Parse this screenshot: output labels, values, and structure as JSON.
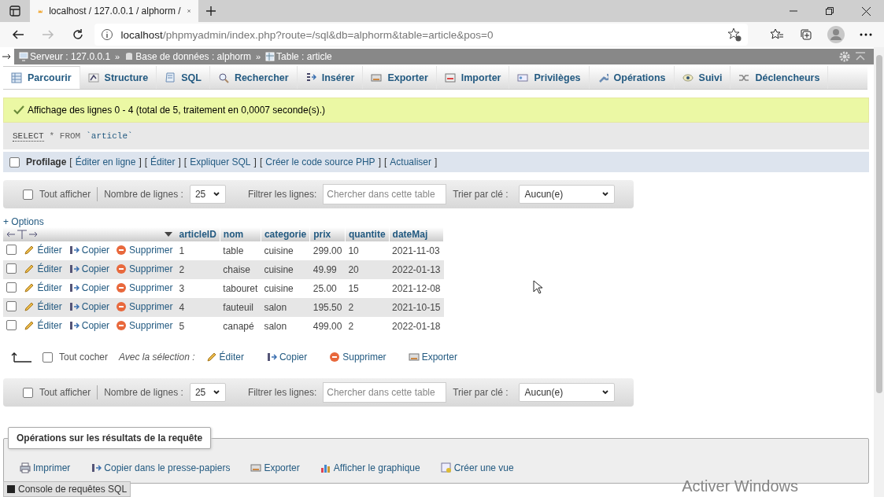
{
  "browser": {
    "tab_title": "localhost / 127.0.0.1 / alphorm /",
    "url_host": "localhost",
    "url_path": "/phpmyadmin/index.php?route=/sql&db=alphorm&table=article&pos=0",
    "forward": {
      "disabled": true
    }
  },
  "breadcrumb": {
    "separator": "»",
    "items": [
      {
        "kind": "server",
        "label": "Serveur : 127.0.0.1"
      },
      {
        "kind": "database",
        "label": "Base de données : alphorm"
      },
      {
        "kind": "table",
        "label": "Table : article"
      }
    ]
  },
  "tabs": [
    {
      "kind": "browse",
      "label": "Parcourir",
      "selected": true
    },
    {
      "kind": "structure",
      "label": "Structure",
      "selected": false
    },
    {
      "kind": "sql",
      "label": "SQL",
      "selected": false
    },
    {
      "kind": "search",
      "label": "Rechercher",
      "selected": false
    },
    {
      "kind": "insert",
      "label": "Insérer",
      "selected": false
    },
    {
      "kind": "export",
      "label": "Exporter",
      "selected": false
    },
    {
      "kind": "import",
      "label": "Importer",
      "selected": false
    },
    {
      "kind": "privileges",
      "label": "Privilèges",
      "selected": false
    },
    {
      "kind": "operations",
      "label": "Opérations",
      "selected": false
    },
    {
      "kind": "tracking",
      "label": "Suivi",
      "selected": false
    },
    {
      "kind": "triggers",
      "label": "Déclencheurs",
      "selected": false
    }
  ],
  "message": "Affichage des lignes 0 - 4 (total de 5, traitement en 0,0007 seconde(s).)",
  "sql": [
    {
      "kind": "keyword",
      "text": "SELECT"
    },
    {
      "kind": "plain",
      "text": "* FROM"
    },
    {
      "kind": "identifier",
      "text": "`article`"
    }
  ],
  "profiling": {
    "label": "Profilage",
    "checked": false,
    "bracket_open": "[",
    "bracket_close": "]",
    "links": [
      "Éditer en ligne",
      "Éditer",
      "Expliquer SQL",
      "Créer le code source PHP",
      "Actualiser"
    ]
  },
  "navigation_top": {
    "show_all": {
      "label": "Tout afficher",
      "checked": false
    },
    "rows_label": "Nombre de lignes :",
    "rows_value": "25",
    "filter_label": "Filtrer les lignes:",
    "filter_placeholder": "Chercher dans cette table",
    "sort_label": "Trier par clé :",
    "sort_value": "Aucun(e)"
  },
  "options_link": "+ Options",
  "table": {
    "columns": [
      "articleID",
      "nom",
      "categorie",
      "prix",
      "quantite",
      "dateMaj"
    ],
    "rows": [
      {
        "checked": false,
        "actions": [
          {
            "kind": "edit",
            "label": "Éditer"
          },
          {
            "kind": "copy",
            "label": "Copier"
          },
          {
            "kind": "delete",
            "label": "Supprimer"
          }
        ],
        "cells": [
          "1",
          "table",
          "cuisine",
          "299.00",
          "10",
          "2021-11-03"
        ]
      },
      {
        "checked": false,
        "actions": [
          {
            "kind": "edit",
            "label": "Éditer"
          },
          {
            "kind": "copy",
            "label": "Copier"
          },
          {
            "kind": "delete",
            "label": "Supprimer"
          }
        ],
        "cells": [
          "2",
          "chaise",
          "cuisine",
          "49.99",
          "20",
          "2022-01-13"
        ]
      },
      {
        "checked": false,
        "actions": [
          {
            "kind": "edit",
            "label": "Éditer"
          },
          {
            "kind": "copy",
            "label": "Copier"
          },
          {
            "kind": "delete",
            "label": "Supprimer"
          }
        ],
        "cells": [
          "3",
          "tabouret",
          "cuisine",
          "25.00",
          "15",
          "2021-12-08"
        ]
      },
      {
        "checked": false,
        "actions": [
          {
            "kind": "edit",
            "label": "Éditer"
          },
          {
            "kind": "copy",
            "label": "Copier"
          },
          {
            "kind": "delete",
            "label": "Supprimer"
          }
        ],
        "cells": [
          "4",
          "fauteuil",
          "salon",
          "195.50",
          "2",
          "2021-10-15"
        ]
      },
      {
        "checked": false,
        "actions": [
          {
            "kind": "edit",
            "label": "Éditer"
          },
          {
            "kind": "copy",
            "label": "Copier"
          },
          {
            "kind": "delete",
            "label": "Supprimer"
          }
        ],
        "cells": [
          "5",
          "canapé",
          "salon",
          "499.00",
          "2",
          "2022-01-18"
        ]
      }
    ]
  },
  "bulk": {
    "check_all": {
      "label": "Tout cocher",
      "checked": false
    },
    "with_selection": "Avec la sélection :",
    "actions": [
      {
        "kind": "edit",
        "label": "Éditer"
      },
      {
        "kind": "copy",
        "label": "Copier"
      },
      {
        "kind": "delete",
        "label": "Supprimer"
      },
      {
        "kind": "export",
        "label": "Exporter"
      }
    ]
  },
  "navigation_bottom": {
    "show_all": {
      "label": "Tout afficher",
      "checked": false
    },
    "rows_label": "Nombre de lignes :",
    "rows_value": "25",
    "filter_label": "Filtrer les lignes:",
    "filter_placeholder": "Chercher dans cette table",
    "sort_label": "Trier par clé :",
    "sort_value": "Aucun(e)"
  },
  "query_operations": {
    "legend": "Opérations sur les résultats de la requête",
    "actions": [
      {
        "kind": "print",
        "label": "Imprimer"
      },
      {
        "kind": "copy",
        "label": "Copier dans le presse-papiers"
      },
      {
        "kind": "export",
        "label": "Exporter"
      },
      {
        "kind": "chart",
        "label": "Afficher le graphique"
      },
      {
        "kind": "view",
        "label": "Créer une vue"
      }
    ]
  },
  "console": {
    "label": "Console de requêtes SQL"
  },
  "os_notice": "Activer Windows"
}
